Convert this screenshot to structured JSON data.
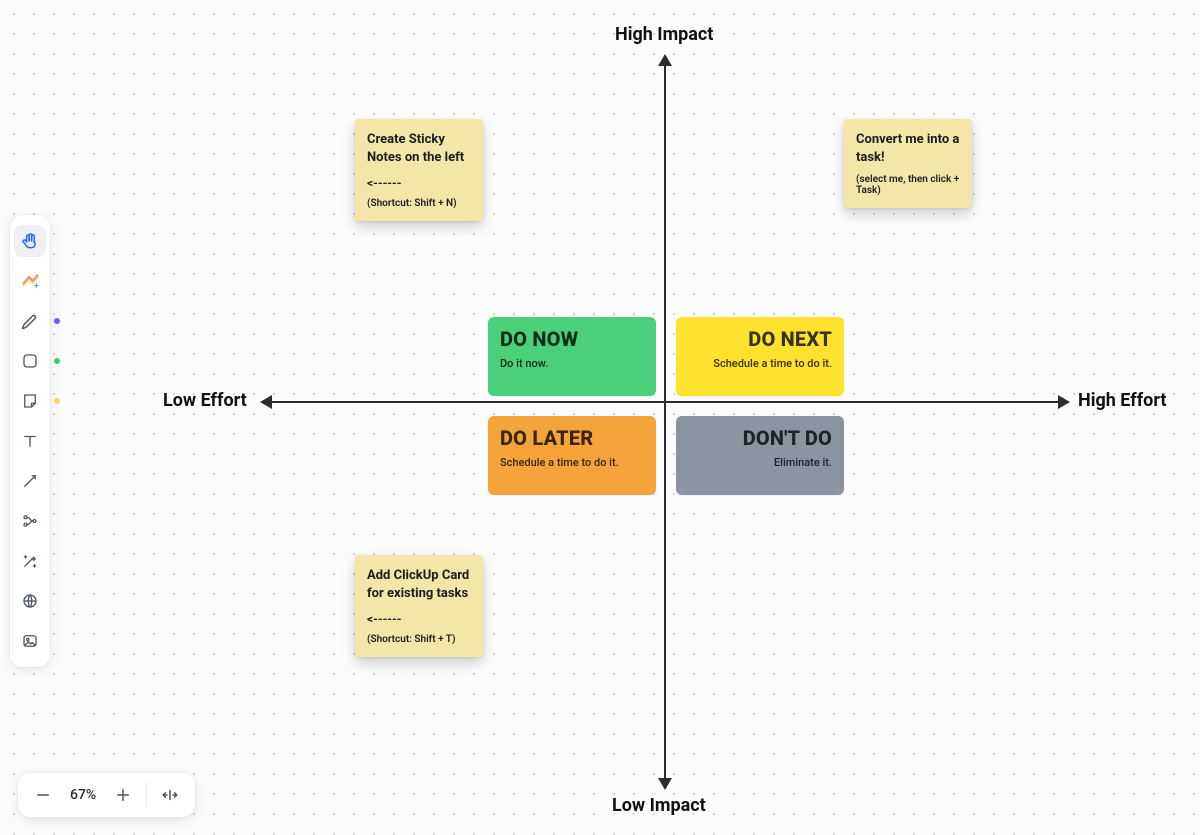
{
  "axes": {
    "top": "High Impact",
    "bottom": "Low Impact",
    "left": "Low Effort",
    "right": "High Effort"
  },
  "quadrants": {
    "do_now": {
      "title": "DO NOW",
      "sub": "Do it now.",
      "bg": "#4bcf7a",
      "align": "left"
    },
    "do_next": {
      "title": "DO NEXT",
      "sub": "Schedule a time to do it.",
      "bg": "#ffe22e",
      "align": "right"
    },
    "do_later": {
      "title": "DO LATER",
      "sub": "Schedule a time to do it.",
      "bg": "#f5a43b",
      "align": "left"
    },
    "dont_do": {
      "title": "DON'T DO",
      "sub": "Eliminate it.",
      "bg": "#8c93a1",
      "align": "right"
    }
  },
  "stickies": {
    "top_left": {
      "heading": "Create Sticky Notes on the left",
      "arrow": "<------",
      "shortcut": "(Shortcut: Shift + N)"
    },
    "top_right": {
      "heading": "Convert me into a task!",
      "sub": "(select me, then click + Task)"
    },
    "bottom_left": {
      "heading": "Add ClickUp Card for existing tasks",
      "arrow": "<------",
      "shortcut": "(Shortcut: Shift + T)"
    }
  },
  "toolbar": {
    "dot_colors": {
      "pen": "#6c5cff",
      "shape": "#3ccf67",
      "sticky": "#f5d95f"
    }
  },
  "zoom": {
    "level": "67%"
  }
}
